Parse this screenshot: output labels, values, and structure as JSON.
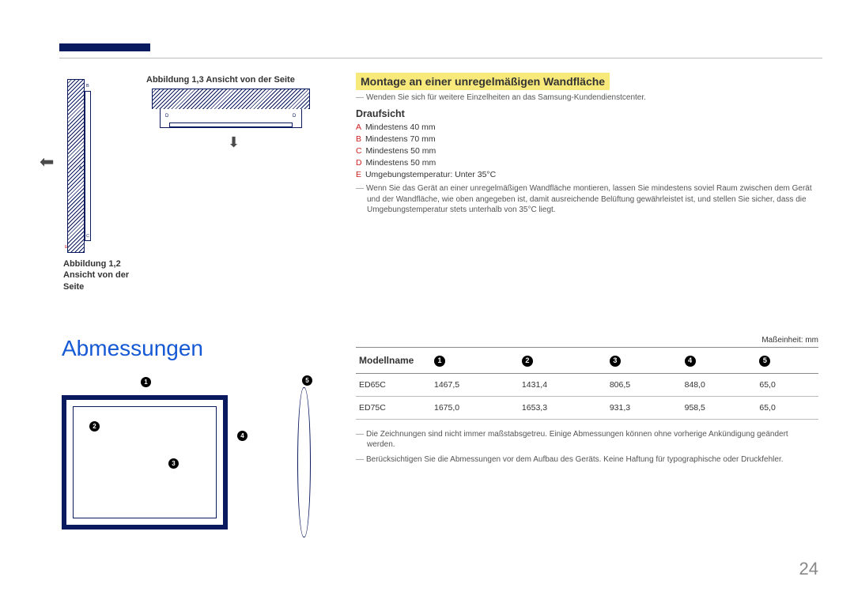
{
  "page_number": "24",
  "header": {},
  "figures": {
    "fig13_label": "Abbildung 1,3 Ansicht von der Seite",
    "fig12_label": "Abbildung 1,2 Ansicht von der Seite",
    "callouts": {
      "A": "A",
      "B": "B",
      "C": "C",
      "D": "D",
      "E": "E"
    }
  },
  "irregular_wall": {
    "title": "Montage an einer unregelmäßigen Wandfläche",
    "contact_note": "Wenden Sie sich für weitere Einzelheiten an das Samsung-Kundendienstcenter.",
    "top_view_title": "Draufsicht",
    "specs": [
      {
        "label": "A",
        "text": "Mindestens 40 mm"
      },
      {
        "label": "B",
        "text": "Mindestens 70 mm"
      },
      {
        "label": "C",
        "text": "Mindestens 50 mm"
      },
      {
        "label": "D",
        "text": "Mindestens 50 mm"
      },
      {
        "label": "E",
        "text": "Umgebungstemperatur: Unter 35°C"
      }
    ],
    "body_note": "Wenn Sie das Gerät an einer unregelmäßigen Wandfläche montieren, lassen Sie mindestens soviel Raum zwischen dem Gerät und der Wandfläche, wie oben angegeben ist, damit ausreichende Belüftung gewährleistet ist, und stellen Sie sicher, dass die Umgebungstemperatur stets unterhalb von 35°C liegt."
  },
  "dimensions": {
    "section_title": "Abmessungen",
    "unit_label": "Maßeinheit: mm",
    "model_header": "Modellname",
    "col_numbers": [
      "1",
      "2",
      "3",
      "4",
      "5"
    ],
    "rows": [
      {
        "model": "ED65C",
        "v1": "1467,5",
        "v2": "1431,4",
        "v3": "806,5",
        "v4": "848,0",
        "v5": "65,0"
      },
      {
        "model": "ED75C",
        "v1": "1675,0",
        "v2": "1653,3",
        "v3": "931,3",
        "v4": "958,5",
        "v5": "65,0"
      }
    ],
    "notes": [
      "Die Zeichnungen sind nicht immer maßstabsgetreu. Einige Abmessungen können ohne vorherige Ankündigung geändert werden.",
      "Berücksichtigen Sie die Abmessungen vor dem Aufbau des Geräts. Keine Haftung für typographische oder Druckfehler."
    ]
  },
  "chart_data": {
    "type": "table",
    "title": "Abmessungen",
    "unit": "mm",
    "columns": [
      "Modellname",
      "1",
      "2",
      "3",
      "4",
      "5"
    ],
    "rows": [
      [
        "ED65C",
        1467.5,
        1431.4,
        806.5,
        848.0,
        65.0
      ],
      [
        "ED75C",
        1675.0,
        1653.3,
        931.3,
        958.5,
        65.0
      ]
    ]
  }
}
